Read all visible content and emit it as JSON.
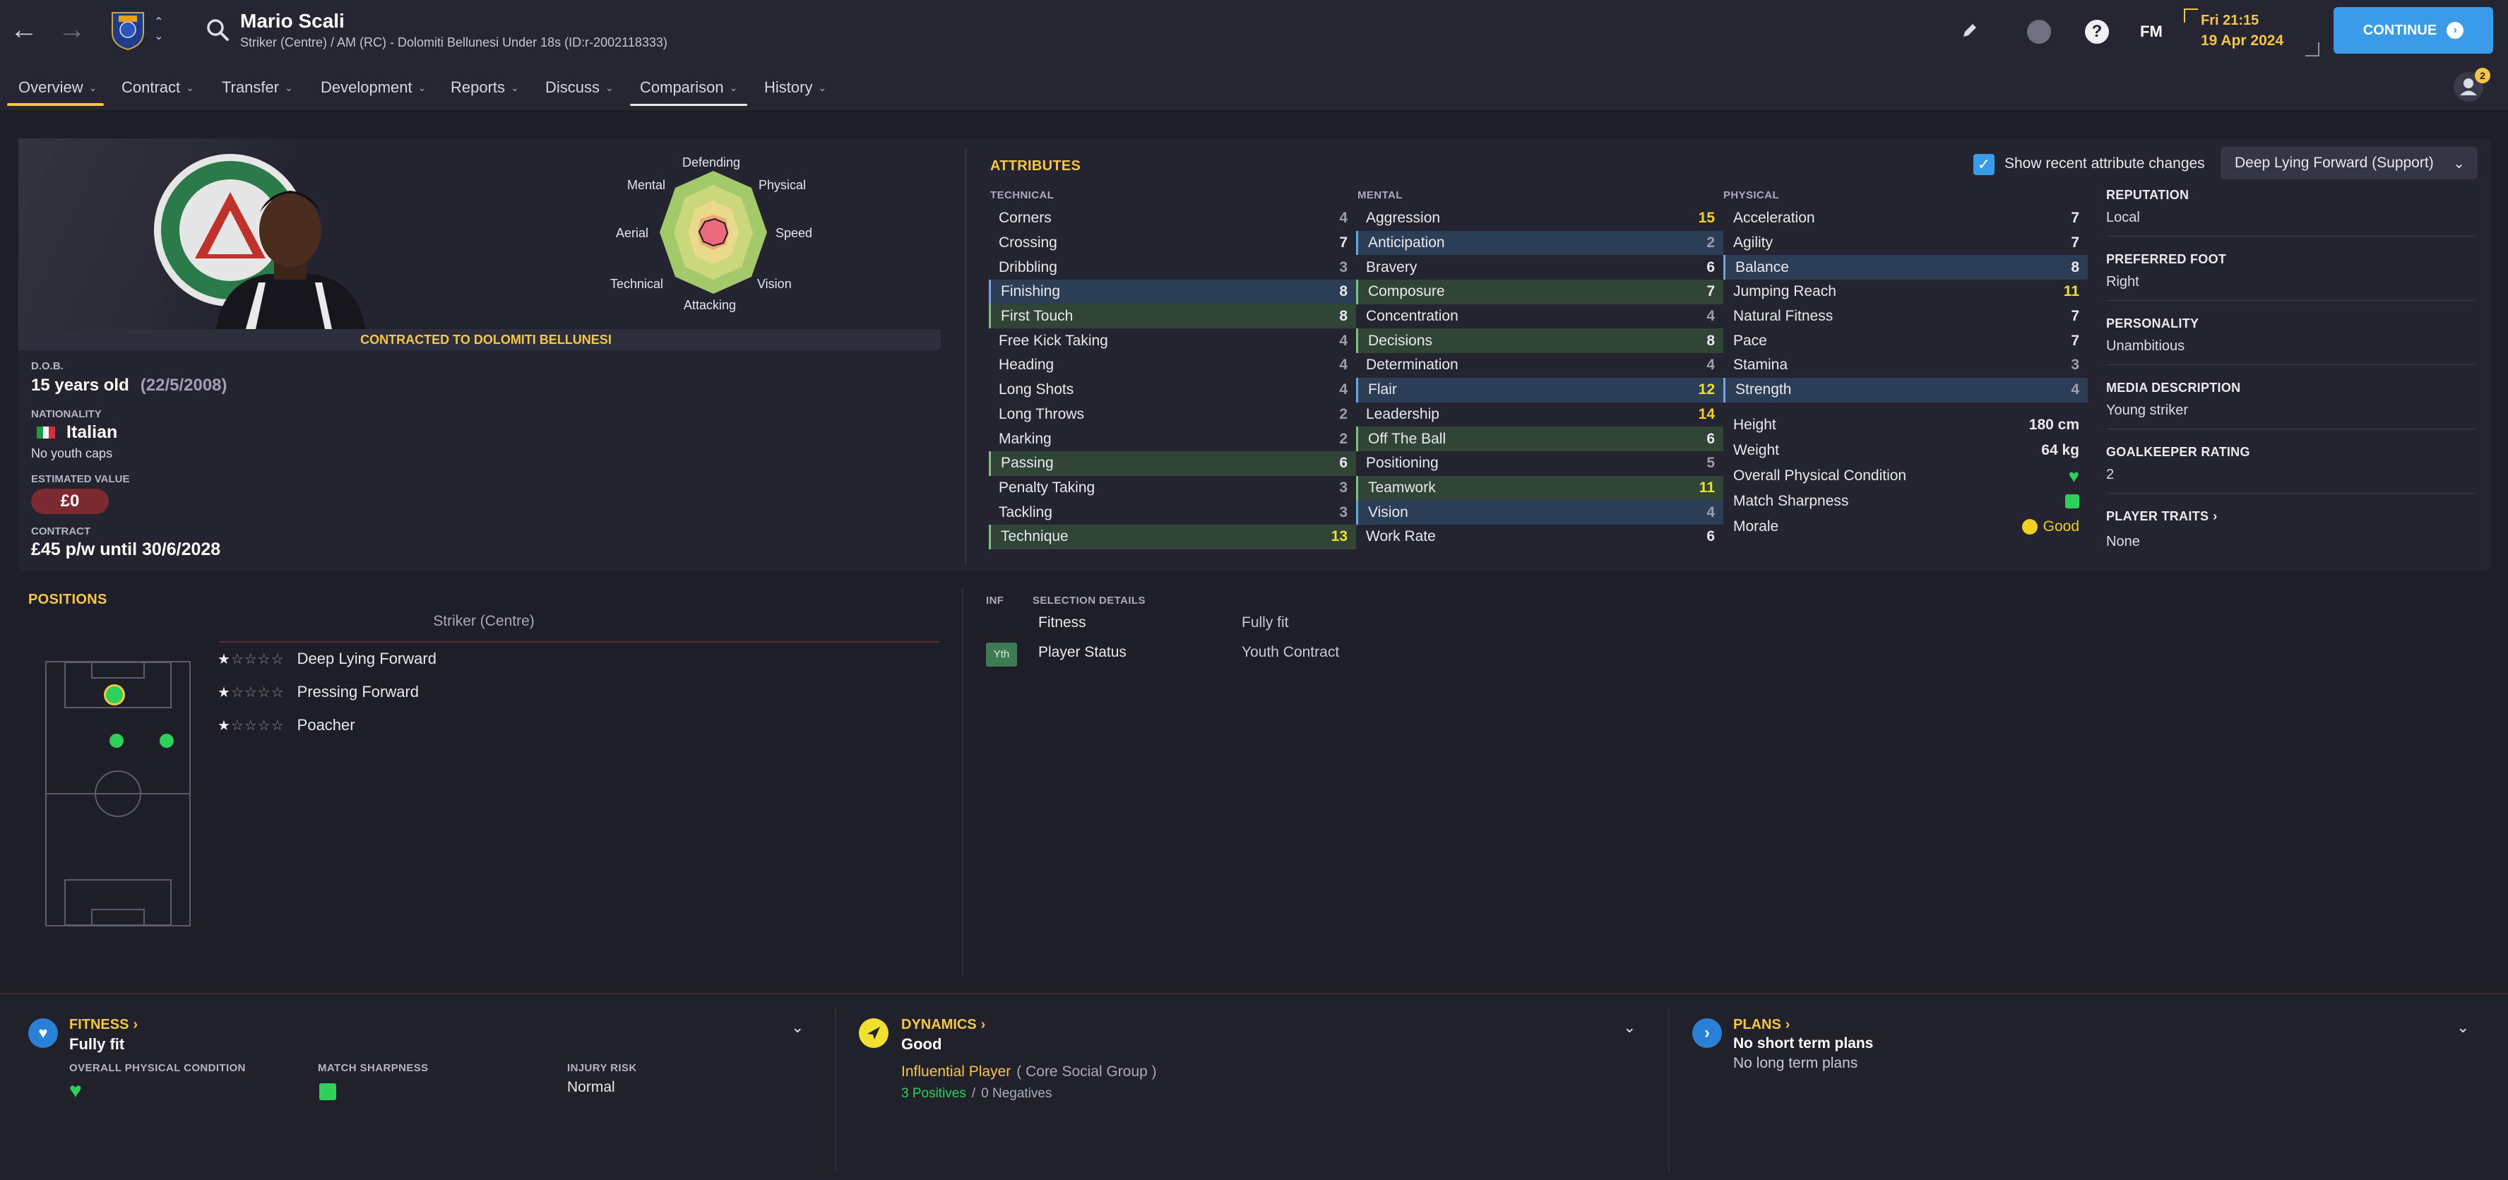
{
  "header": {
    "player_name": "Mario Scali",
    "player_subtitle": "Striker (Centre) / AM (RC) - Dolomiti Bellunesi Under 18s (ID:r-2002118333)",
    "date_line1": "Fri 21:15",
    "date_line2": "19 Apr 2024",
    "fm_label": "FM",
    "continue_label": "CONTINUE",
    "notification_count": "2"
  },
  "tabs": [
    {
      "label": "Overview",
      "active": true
    },
    {
      "label": "Contract"
    },
    {
      "label": "Transfer"
    },
    {
      "label": "Development"
    },
    {
      "label": "Reports"
    },
    {
      "label": "Discuss"
    },
    {
      "label": "Comparison",
      "underline": true
    },
    {
      "label": "History"
    }
  ],
  "profile": {
    "contract_banner": "CONTRACTED TO DOLOMITI BELLUNESI",
    "dob_label": "D.O.B.",
    "dob_age": "15 years old",
    "dob_date": "(22/5/2008)",
    "nationality_label": "NATIONALITY",
    "nationality": "Italian",
    "youth_caps": "No youth caps",
    "value_label": "ESTIMATED VALUE",
    "value": "£0",
    "contract_label": "CONTRACT",
    "contract": "£45 p/w until 30/6/2028",
    "radar_labels": {
      "defending": "Defending",
      "physical": "Physical",
      "speed": "Speed",
      "vision": "Vision",
      "attacking": "Attacking",
      "technical": "Technical",
      "aerial": "Aerial",
      "mental": "Mental"
    }
  },
  "attributes": {
    "title": "ATTRIBUTES",
    "show_changes_label": "Show recent attribute changes",
    "role_select": "Deep Lying Forward (Support)",
    "technical_header": "TECHNICAL",
    "mental_header": "MENTAL",
    "physical_header": "PHYSICAL",
    "technical": [
      {
        "name": "Corners",
        "value": "4",
        "hl": ""
      },
      {
        "name": "Crossing",
        "value": "7",
        "hl": ""
      },
      {
        "name": "Dribbling",
        "value": "3",
        "hl": ""
      },
      {
        "name": "Finishing",
        "value": "8",
        "hl": "blue"
      },
      {
        "name": "First Touch",
        "value": "8",
        "hl": "green"
      },
      {
        "name": "Free Kick Taking",
        "value": "4",
        "hl": ""
      },
      {
        "name": "Heading",
        "value": "4",
        "hl": ""
      },
      {
        "name": "Long Shots",
        "value": "4",
        "hl": ""
      },
      {
        "name": "Long Throws",
        "value": "2",
        "hl": ""
      },
      {
        "name": "Marking",
        "value": "2",
        "hl": ""
      },
      {
        "name": "Passing",
        "value": "6",
        "hl": "green"
      },
      {
        "name": "Penalty Taking",
        "value": "3",
        "hl": ""
      },
      {
        "name": "Tackling",
        "value": "3",
        "hl": ""
      },
      {
        "name": "Technique",
        "value": "13",
        "hl": "green"
      }
    ],
    "mental": [
      {
        "name": "Aggression",
        "value": "15",
        "hl": ""
      },
      {
        "name": "Anticipation",
        "value": "2",
        "hl": "blue"
      },
      {
        "name": "Bravery",
        "value": "6",
        "hl": ""
      },
      {
        "name": "Composure",
        "value": "7",
        "hl": "green"
      },
      {
        "name": "Concentration",
        "value": "4",
        "hl": ""
      },
      {
        "name": "Decisions",
        "value": "8",
        "hl": "green"
      },
      {
        "name": "Determination",
        "value": "4",
        "hl": ""
      },
      {
        "name": "Flair",
        "value": "12",
        "hl": "blue"
      },
      {
        "name": "Leadership",
        "value": "14",
        "hl": ""
      },
      {
        "name": "Off The Ball",
        "value": "6",
        "hl": "green"
      },
      {
        "name": "Positioning",
        "value": "5",
        "hl": ""
      },
      {
        "name": "Teamwork",
        "value": "11",
        "hl": "green"
      },
      {
        "name": "Vision",
        "value": "4",
        "hl": "blue"
      },
      {
        "name": "Work Rate",
        "value": "6",
        "hl": ""
      }
    ],
    "physical": [
      {
        "name": "Acceleration",
        "value": "7",
        "hl": ""
      },
      {
        "name": "Agility",
        "value": "7",
        "hl": ""
      },
      {
        "name": "Balance",
        "value": "8",
        "hl": "blue"
      },
      {
        "name": "Jumping Reach",
        "value": "11",
        "hl": ""
      },
      {
        "name": "Natural Fitness",
        "value": "7",
        "hl": ""
      },
      {
        "name": "Pace",
        "value": "7",
        "hl": ""
      },
      {
        "name": "Stamina",
        "value": "3",
        "hl": ""
      },
      {
        "name": "Strength",
        "value": "4",
        "hl": "blue"
      }
    ],
    "extra": {
      "height_label": "Height",
      "height": "180 cm",
      "weight_label": "Weight",
      "weight": "64 kg",
      "opc_label": "Overall Physical Condition",
      "sharpness_label": "Match Sharpness",
      "morale_label": "Morale",
      "morale": "Good"
    }
  },
  "side_info": {
    "reputation_label": "REPUTATION",
    "reputation": "Local",
    "foot_label": "PREFERRED FOOT",
    "foot": "Right",
    "personality_label": "PERSONALITY",
    "personality": "Unambitious",
    "media_label": "MEDIA DESCRIPTION",
    "media": "Young striker",
    "gk_label": "GOALKEEPER RATING",
    "gk": "2",
    "traits_label": "PLAYER TRAITS",
    "traits": "None"
  },
  "positions": {
    "title": "POSITIONS",
    "current": "Striker (Centre)",
    "roles": [
      {
        "name": "Deep Lying Forward",
        "stars": 1.5
      },
      {
        "name": "Pressing Forward",
        "stars": 1.5
      },
      {
        "name": "Poacher",
        "stars": 1.5
      }
    ]
  },
  "selection": {
    "inf_label": "INF",
    "title": "SELECTION DETAILS",
    "rows": [
      {
        "badge": "",
        "label": "Fitness",
        "value": "Fully fit"
      },
      {
        "badge": "Yth",
        "label": "Player Status",
        "value": "Youth Contract"
      }
    ]
  },
  "footer": {
    "fitness": {
      "title": "FITNESS",
      "value": "Fully fit",
      "opc_label": "OVERALL PHYSICAL CONDITION",
      "sharpness_label": "MATCH SHARPNESS",
      "injury_label": "INJURY RISK",
      "injury": "Normal"
    },
    "dynamics": {
      "title": "DYNAMICS",
      "value": "Good",
      "role": "Influential Player",
      "group": "( Core Social Group )",
      "positives": "3 Positives",
      "sep": "/",
      "negatives": "0 Negatives"
    },
    "plans": {
      "title": "PLANS",
      "short": "No short term plans",
      "long": "No long term plans"
    }
  },
  "colors": {
    "accent": "#f7c548",
    "continue": "#3a9be8",
    "green_hl": "#304536",
    "blue_hl": "#2c3d56",
    "fitness_icon": "#2a7fd6",
    "dynamics_icon": "#f0e030"
  }
}
